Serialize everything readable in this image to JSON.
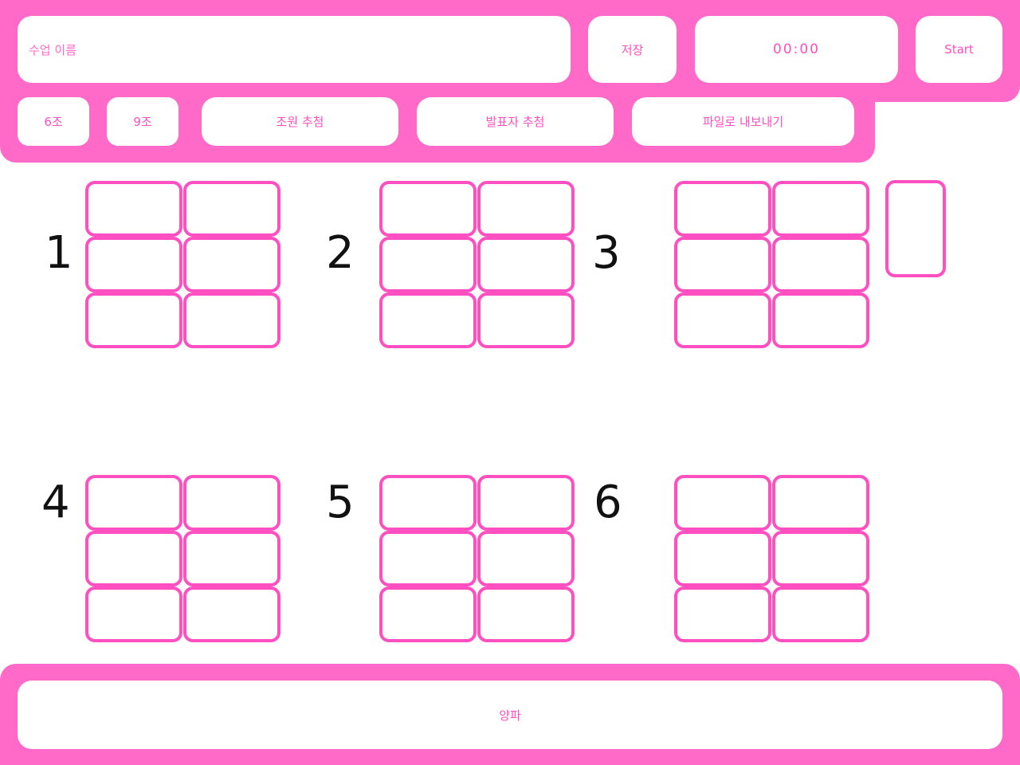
{
  "header": {
    "lesson_name_placeholder": "수업 이름",
    "save_label": "저장",
    "timer_value": "00:00",
    "start_label": "Start"
  },
  "toolbar": {
    "six_groups_label": "6조",
    "nine_groups_label": "9조",
    "member_draw_label": "조원 추첨",
    "presenter_draw_label": "발표자 추첨",
    "export_label": "파일로 내보내기"
  },
  "groups": [
    {
      "number": "1"
    },
    {
      "number": "2"
    },
    {
      "number": "3"
    },
    {
      "number": "4"
    },
    {
      "number": "5"
    },
    {
      "number": "6"
    }
  ],
  "footer": {
    "label": "양파"
  },
  "colors": {
    "accent": "#ff6ac9",
    "border": "#ff4fc0",
    "text_accent": "#ff4fc0"
  }
}
